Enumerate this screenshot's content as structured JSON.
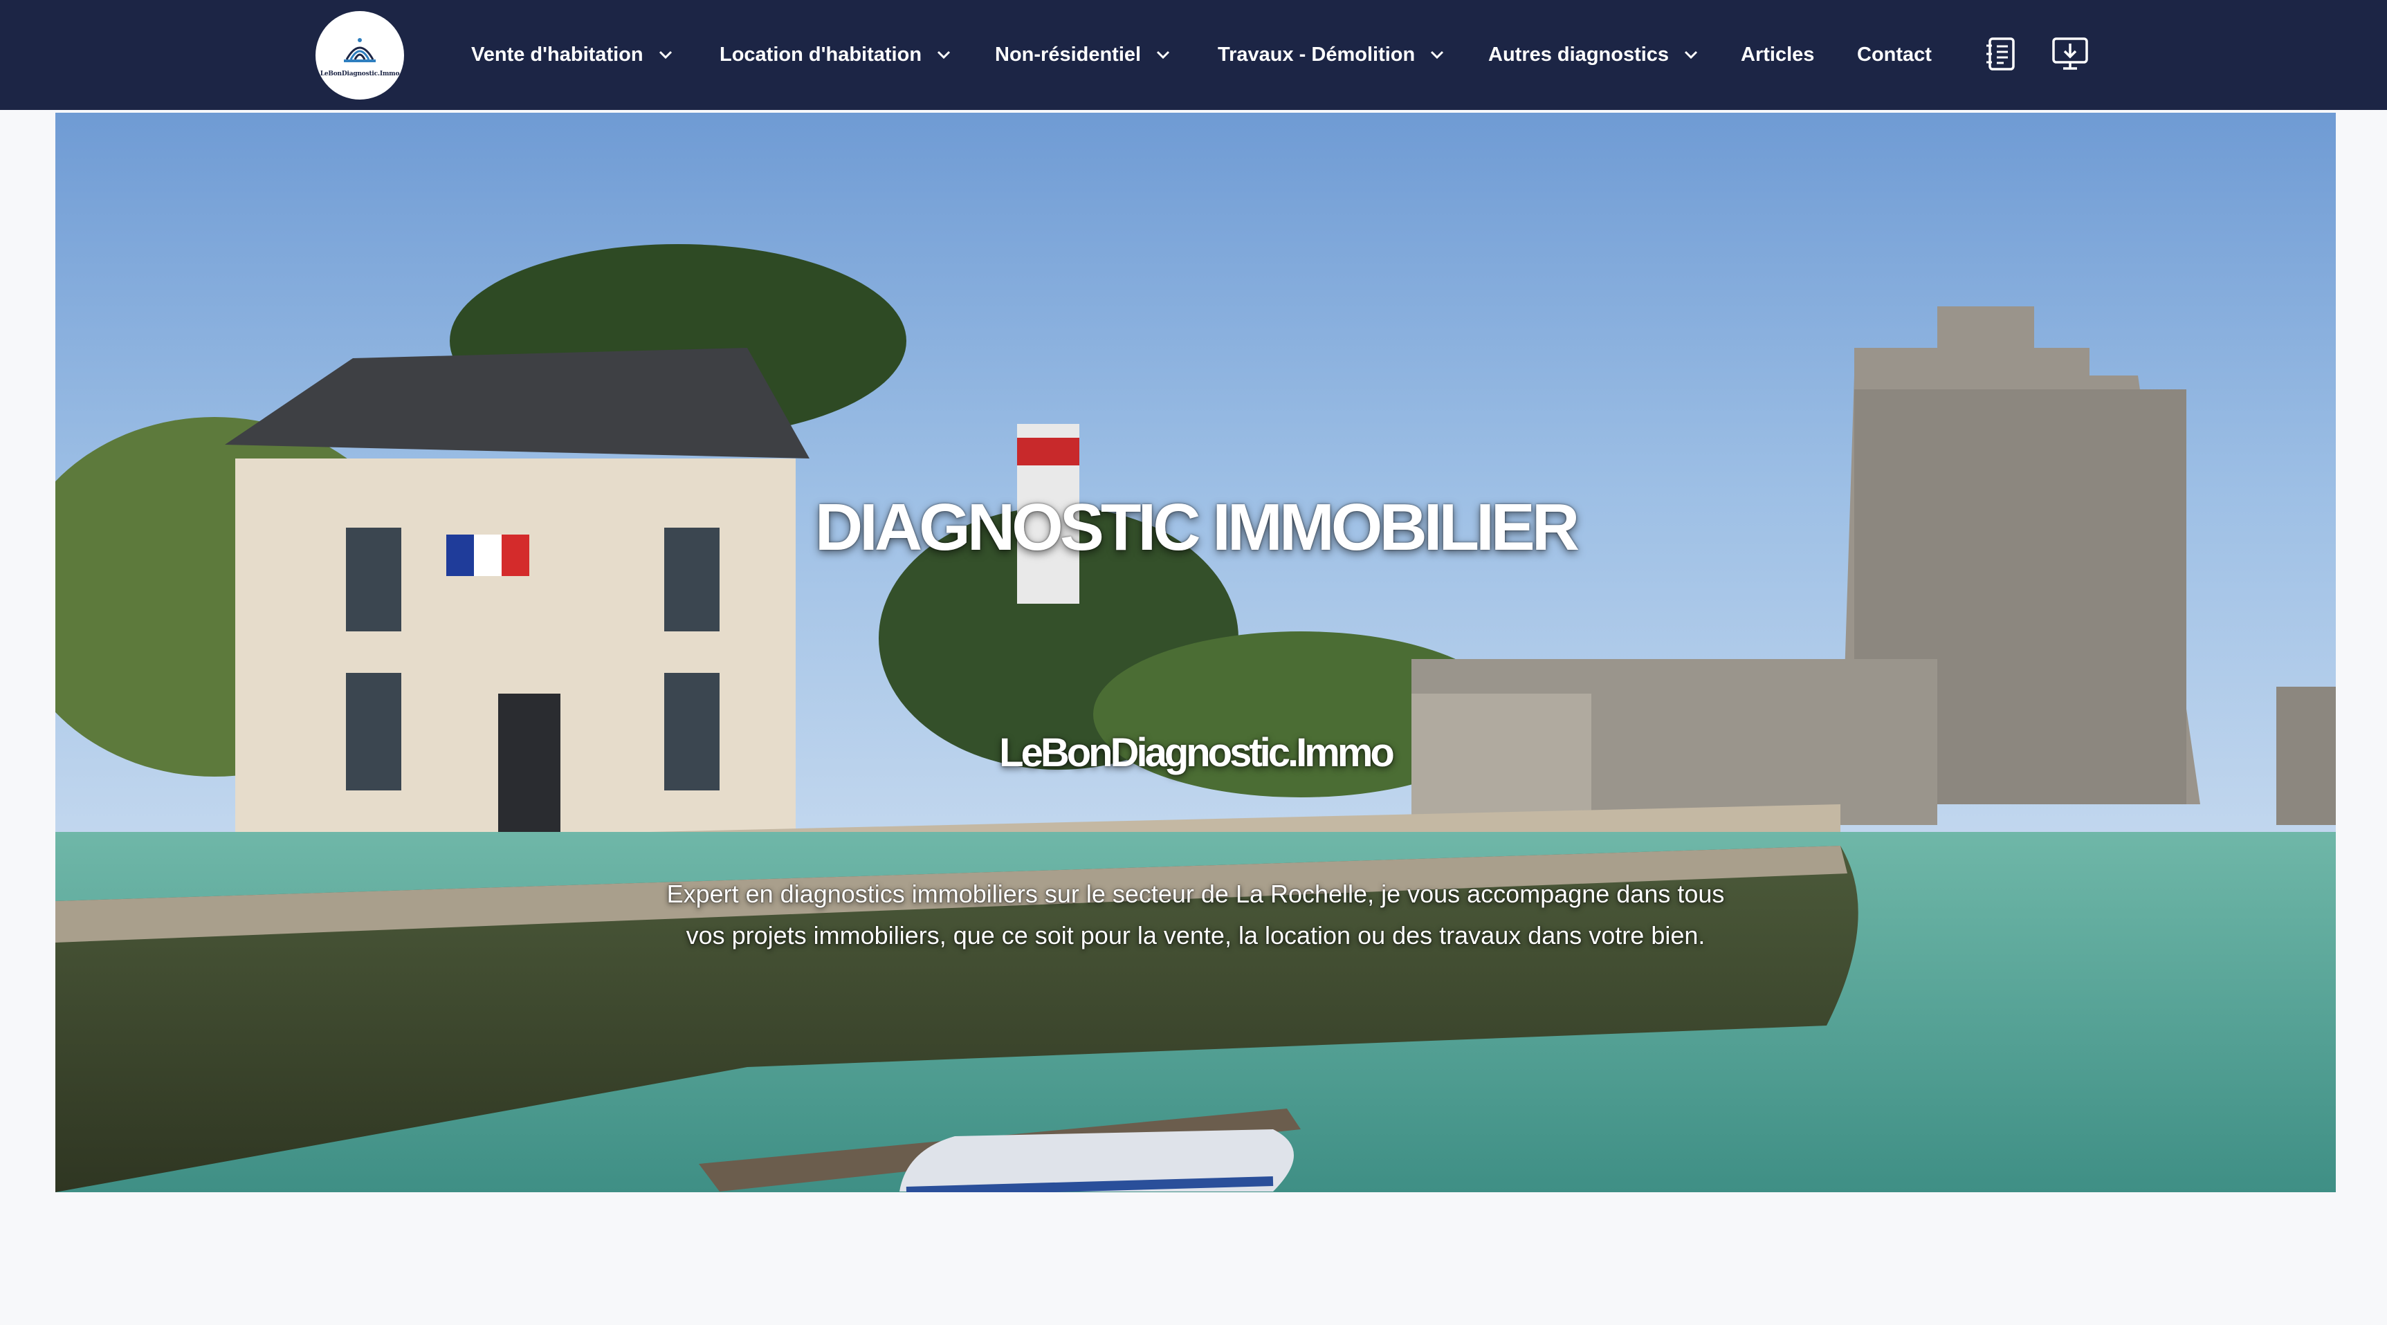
{
  "nav": {
    "logo_text": "LeBonDiagnostic.Immo",
    "items": [
      {
        "label": "Vente d'habitation",
        "has_dropdown": true
      },
      {
        "label": "Location d'habitation",
        "has_dropdown": true
      },
      {
        "label": "Non-résidentiel",
        "has_dropdown": true
      },
      {
        "label": "Travaux - Démolition",
        "has_dropdown": true
      },
      {
        "label": "Autres diagnostics",
        "has_dropdown": true
      },
      {
        "label": "Articles",
        "has_dropdown": false
      },
      {
        "label": "Contact",
        "has_dropdown": false
      }
    ],
    "icons": [
      "notebook-icon",
      "monitor-download-icon"
    ]
  },
  "hero": {
    "title": "DIAGNOSTIC IMMOBILIER",
    "subtitle": "LeBonDiagnostic.Immo",
    "description_line1": "Expert en diagnostics immobiliers sur le secteur de La Rochelle, je vous accompagne dans tous",
    "description_line2": "vos projets immobiliers, que ce soit pour la vente, la location ou des travaux dans votre bien."
  },
  "colors": {
    "navbar_bg": "#1c2545",
    "nav_text": "#ffffff",
    "page_bg": "#f7f8fa"
  }
}
